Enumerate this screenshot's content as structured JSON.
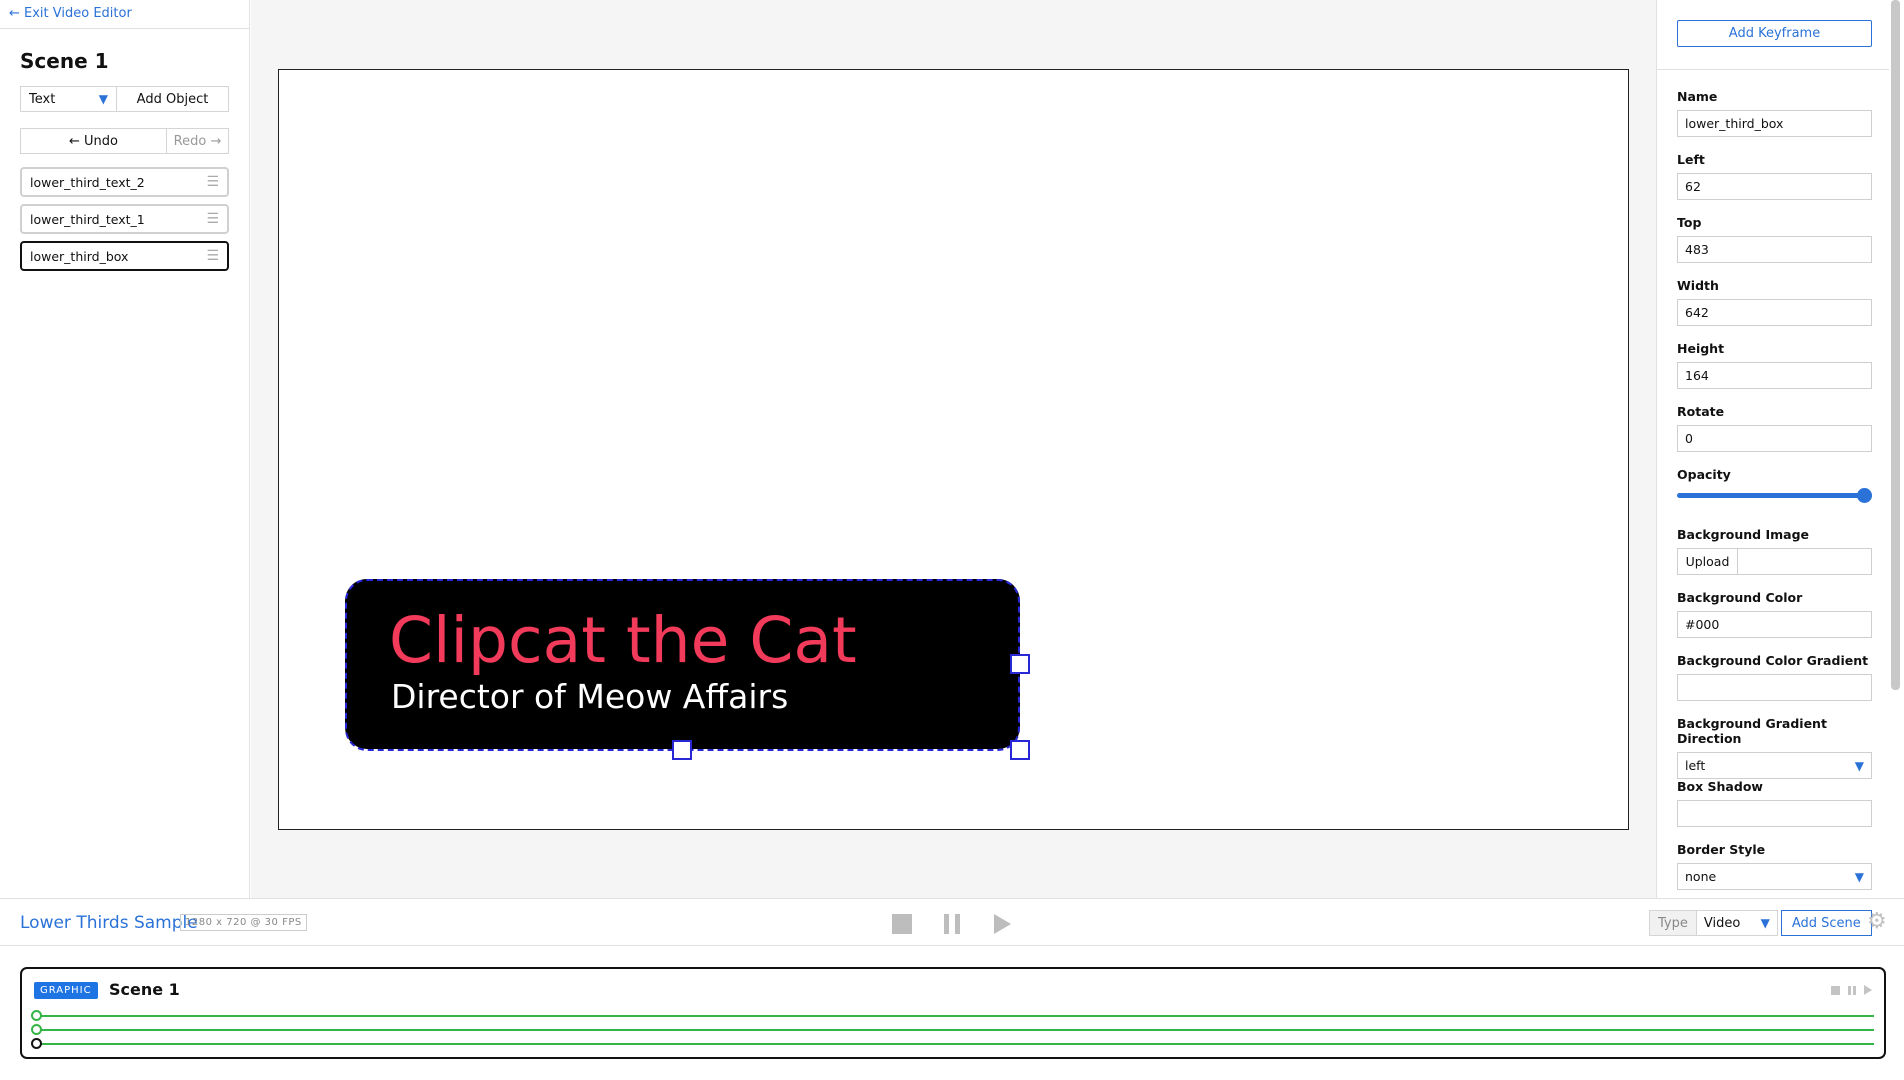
{
  "sidebar": {
    "exit_label": "← Exit Video Editor",
    "scene_title": "Scene 1",
    "object_type": "Text",
    "add_object_label": "Add Object",
    "undo_label": "← Undo",
    "redo_label": "Redo →",
    "layers": [
      {
        "name": "lower_third_text_2",
        "selected": false
      },
      {
        "name": "lower_third_text_1",
        "selected": false
      },
      {
        "name": "lower_third_box",
        "selected": true
      }
    ]
  },
  "canvas": {
    "lower_third_title": "Clipcat the Cat",
    "lower_third_subtitle": "Director of Meow Affairs",
    "title_color": "#f23a5a",
    "box_color": "#000000",
    "selection_color": "#2727d8"
  },
  "properties": {
    "add_keyframe_label": "Add Keyframe",
    "name_label": "Name",
    "name_value": "lower_third_box",
    "left_label": "Left",
    "left_value": "62",
    "top_label": "Top",
    "top_value": "483",
    "width_label": "Width",
    "width_value": "642",
    "height_label": "Height",
    "height_value": "164",
    "rotate_label": "Rotate",
    "rotate_value": "0",
    "opacity_label": "Opacity",
    "opacity_value": 1.0,
    "bg_image_label": "Background Image",
    "upload_label": "Upload",
    "bg_image_value": "",
    "bg_color_label": "Background Color",
    "bg_color_value": "#000",
    "bg_gradient_label": "Background Color Gradient",
    "bg_gradient_value": "",
    "bg_gradient_dir_label": "Background Gradient Direction",
    "bg_gradient_dir_value": "left",
    "box_shadow_label": "Box Shadow",
    "box_shadow_value": "",
    "border_style_label": "Border Style",
    "border_style_value": "none"
  },
  "toolbar": {
    "project_name": "Lower Thirds Sample",
    "project_meta": "1280 x 720 @ 30 FPS",
    "type_label": "Type",
    "type_value": "Video",
    "add_scene_label": "Add Scene",
    "icons": [
      "stop-icon",
      "pause-icon",
      "play-icon",
      "gear-icon"
    ]
  },
  "timeline": {
    "badge": "GRAPHIC",
    "scene_name": "Scene 1",
    "track_color": "#35b548",
    "tracks": 3
  },
  "accent_color": "#2a72d8"
}
